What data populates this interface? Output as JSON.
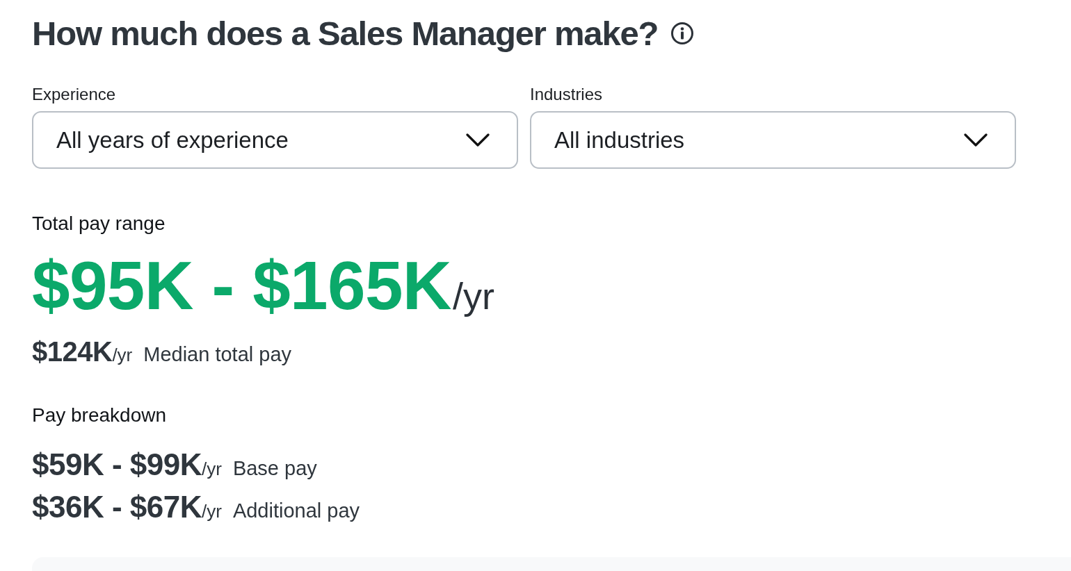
{
  "header": {
    "title": "How much does a Sales Manager make?"
  },
  "filters": [
    {
      "label": "Experience",
      "value": "All years of experience"
    },
    {
      "label": "Industries",
      "value": "All industries"
    }
  ],
  "total_pay": {
    "label": "Total pay range",
    "range": "$95K - $165K",
    "unit": "/yr",
    "median": {
      "amount": "$124K",
      "unit": "/yr",
      "label": "Median total pay"
    }
  },
  "breakdown": {
    "title": "Pay breakdown",
    "rows": [
      {
        "range": "$59K - $99K",
        "unit": "/yr",
        "label": "Base pay"
      },
      {
        "range": "$36K - $67K",
        "unit": "/yr",
        "label": "Additional pay"
      }
    ]
  }
}
